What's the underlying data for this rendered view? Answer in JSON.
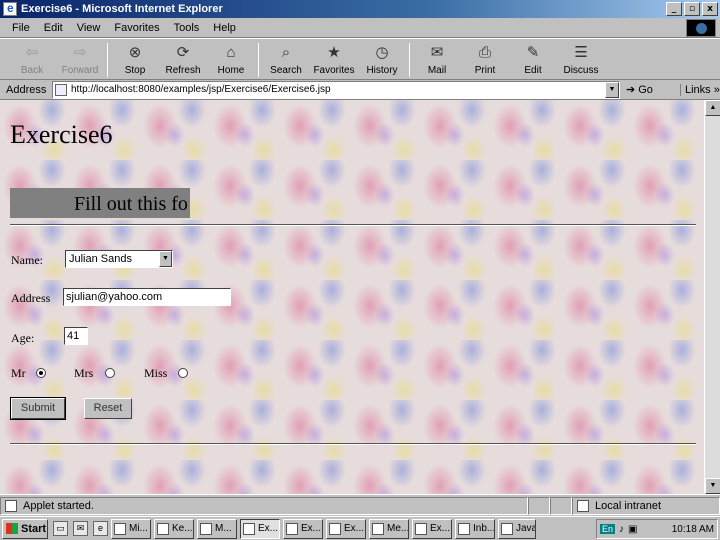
{
  "window": {
    "title": "Exercise6 - Microsoft Internet Explorer",
    "buttons": [
      "_",
      "▫",
      "x"
    ]
  },
  "menu": [
    "File",
    "Edit",
    "View",
    "Favorites",
    "Tools",
    "Help"
  ],
  "toolbar": [
    {
      "label": "Back",
      "icon": "back-arrow-icon",
      "glyph": "⇦",
      "disabled": true
    },
    {
      "label": "Forward",
      "icon": "forward-arrow-icon",
      "glyph": "⇨",
      "disabled": true
    },
    {
      "label": "Stop",
      "icon": "stop-icon",
      "glyph": "⊗",
      "disabled": false
    },
    {
      "label": "Refresh",
      "icon": "refresh-icon",
      "glyph": "⟳",
      "disabled": false
    },
    {
      "label": "Home",
      "icon": "home-icon",
      "glyph": "⌂",
      "disabled": false
    },
    {
      "label": "Search",
      "icon": "search-icon",
      "glyph": "⌕",
      "disabled": false
    },
    {
      "label": "Favorites",
      "icon": "favorites-icon",
      "glyph": "★",
      "disabled": false
    },
    {
      "label": "History",
      "icon": "history-icon",
      "glyph": "◷",
      "disabled": false
    },
    {
      "label": "Mail",
      "icon": "mail-icon",
      "glyph": "✉",
      "disabled": false
    },
    {
      "label": "Print",
      "icon": "print-icon",
      "glyph": "⎙",
      "disabled": false
    },
    {
      "label": "Edit",
      "icon": "edit-icon",
      "glyph": "✎",
      "disabled": false
    },
    {
      "label": "Discuss",
      "icon": "discuss-icon",
      "glyph": "☰",
      "disabled": false
    }
  ],
  "address": {
    "label": "Address",
    "url": "http://localhost:8080/examples/jsp/Exercise6/Exercise6.jsp",
    "go": "Go",
    "links": "Links »"
  },
  "page": {
    "heading": "Exercise6",
    "banner": "Fill out this fo",
    "name_label": "Name:",
    "name_value": "Julian Sands",
    "address_label": "Address",
    "address_value": "sjulian@yahoo.com",
    "age_label": "Age:",
    "age_value": "41",
    "radio": [
      {
        "label": "Mr",
        "checked": true
      },
      {
        "label": "Mrs",
        "checked": false
      },
      {
        "label": "Miss",
        "checked": false
      }
    ],
    "submit": "Submit",
    "reset": "Reset"
  },
  "status": {
    "text": "Applet started.",
    "zone": "Local intranet"
  },
  "taskbar": {
    "start": "Start",
    "tasks": [
      "Mi...",
      "Ke...",
      "M...",
      "Ex...",
      "Ex...",
      "Ex...",
      "Me...",
      "Ex...",
      "Inb...",
      "Java"
    ],
    "active_index": 3,
    "lang": "En",
    "clock": "10:18 AM"
  }
}
